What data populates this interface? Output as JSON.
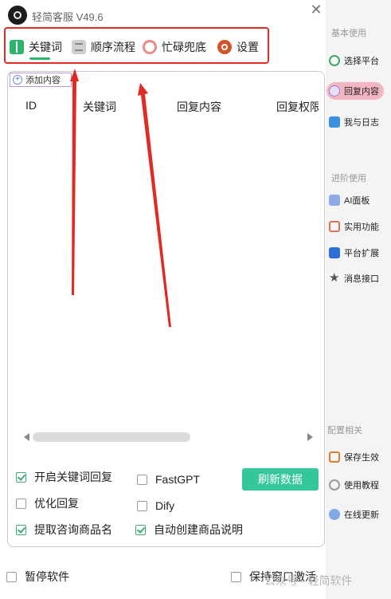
{
  "app": {
    "title": "轻简客服 V49.6",
    "close_glyph": "✕"
  },
  "tabs": [
    {
      "label": "关键词",
      "icon": "book-icon",
      "active": true
    },
    {
      "label": "顺序流程",
      "icon": "list-icon"
    },
    {
      "label": "忙碌兜底",
      "icon": "clover-icon"
    },
    {
      "label": "设置",
      "icon": "gear-icon"
    }
  ],
  "content": {
    "add_label": "添加内容",
    "columns": [
      "ID",
      "关键词",
      "回复内容",
      "回复权限"
    ]
  },
  "options": {
    "enable_keyword_reply": {
      "label": "开启关键词回复",
      "checked": true
    },
    "optimize_reply": {
      "label": "优化回复",
      "checked": false
    },
    "extract_product_name": {
      "label": "提取咨询商品名",
      "checked": true
    },
    "fastgpt": {
      "label": "FastGPT",
      "checked": false
    },
    "dify": {
      "label": "Dify",
      "checked": false
    },
    "auto_create_desc": {
      "label": "自动创建商品说明",
      "checked": true
    },
    "refresh_label": "刷新数据"
  },
  "sidebar": {
    "sections": [
      {
        "title": "基本使用",
        "items": [
          {
            "label": "选择平台",
            "icon": "leaf-icon"
          },
          {
            "label": "回复内容",
            "icon": "chat-icon",
            "active": true
          },
          {
            "label": "我与日志",
            "icon": "id-card-icon"
          }
        ]
      },
      {
        "title": "进阶使用",
        "items": [
          {
            "label": "AI面板",
            "icon": "ai-icon"
          },
          {
            "label": "实用功能",
            "icon": "tools-icon"
          },
          {
            "label": "平台扩展",
            "icon": "extend-icon"
          },
          {
            "label": "消息接口",
            "icon": "star-icon"
          }
        ]
      },
      {
        "title": "配置相关",
        "items": [
          {
            "label": "保存生效",
            "icon": "edit-icon"
          },
          {
            "label": "使用教程",
            "icon": "globe-icon"
          },
          {
            "label": "在线更新",
            "icon": "update-icon"
          }
        ]
      }
    ]
  },
  "footer": {
    "pause": {
      "label": "暂停软件",
      "checked": false
    },
    "keep_active": {
      "label": "保持窗口激活",
      "checked": false
    },
    "watermark": "公众号 · 轻简软件"
  },
  "colors": {
    "accent": "#35c79a",
    "tab_active": "#2fb46e",
    "annotation_red": "#e12a24",
    "sidebar_active": "#f3b6c1"
  }
}
